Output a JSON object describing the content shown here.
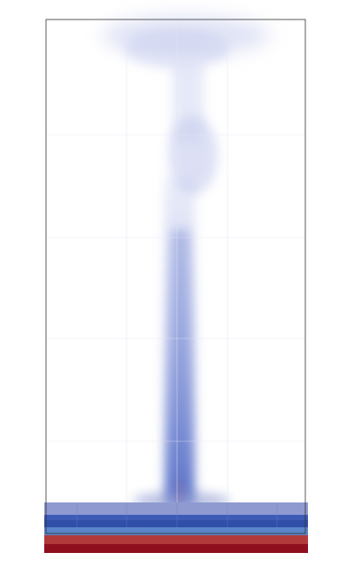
{
  "scene": {
    "colors": {
      "background": "#ffffff",
      "outline": "#333333",
      "plume": "#3f5bbf",
      "plume_light": "#c7cdee",
      "band_light_blue": "#8e9ad0",
      "band_mid_blue": "#3d5bb5",
      "band_dark_blue": "#2f4fa8",
      "band_sky_blue": "#5a86c9",
      "band_red": "#b23a3a",
      "band_dark_red": "#8f0f1f"
    },
    "domain_outline": true
  }
}
